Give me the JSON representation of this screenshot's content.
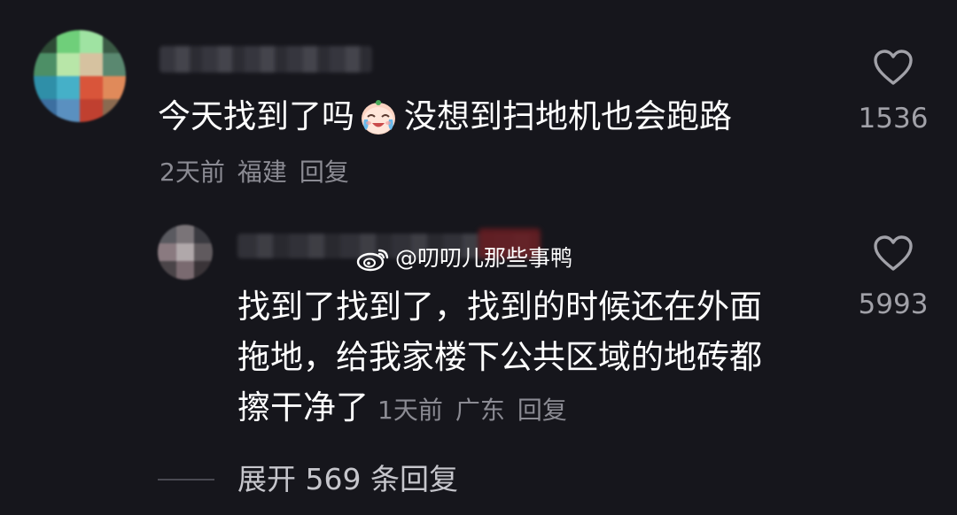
{
  "comments": [
    {
      "text_before_emoji": "今天找到了吗",
      "emoji": "crying-laughing-emoji",
      "text_after_emoji": "没想到扫地机也会跑路",
      "time": "2天前",
      "location": "福建",
      "reply_label": "回复",
      "likes": "1536",
      "avatar_colors": [
        "#2d4a35",
        "#6fcf7a",
        "#9fe3a2",
        "#3a5a45",
        "#4d8f66",
        "#b8e6a8",
        "#d6c2a0",
        "#5a8870",
        "#2f8fa8",
        "#45b0c8",
        "#d9553a",
        "#e08a5a",
        "#3c6fa0",
        "#5a90c0",
        "#c04030",
        "#8a6a50"
      ]
    }
  ],
  "reply": {
    "line1": "找到了找到了，找到的时候还在外面",
    "line2": "拖地，给我家楼下公共区域的地砖都",
    "line3": "擦干净了",
    "time": "1天前",
    "location": "广东",
    "reply_label": "回复",
    "likes": "5993",
    "avatar_colors": [
      "#5a5a60",
      "#7a7478",
      "#3a3a40",
      "#8a7a80",
      "#b0a8aa",
      "#605a5e",
      "#4a4448",
      "#7a6a70",
      "#3a3438"
    ]
  },
  "watermark": {
    "icon": "weibo-icon",
    "text": "@叨叨儿那些事鸭"
  },
  "expand": {
    "label": "展开 569 条回复"
  },
  "colors": {
    "background": "#16161c",
    "text_primary": "#ffffff",
    "text_secondary": "#8b8b93",
    "like_icon": "#a1a1a8"
  }
}
